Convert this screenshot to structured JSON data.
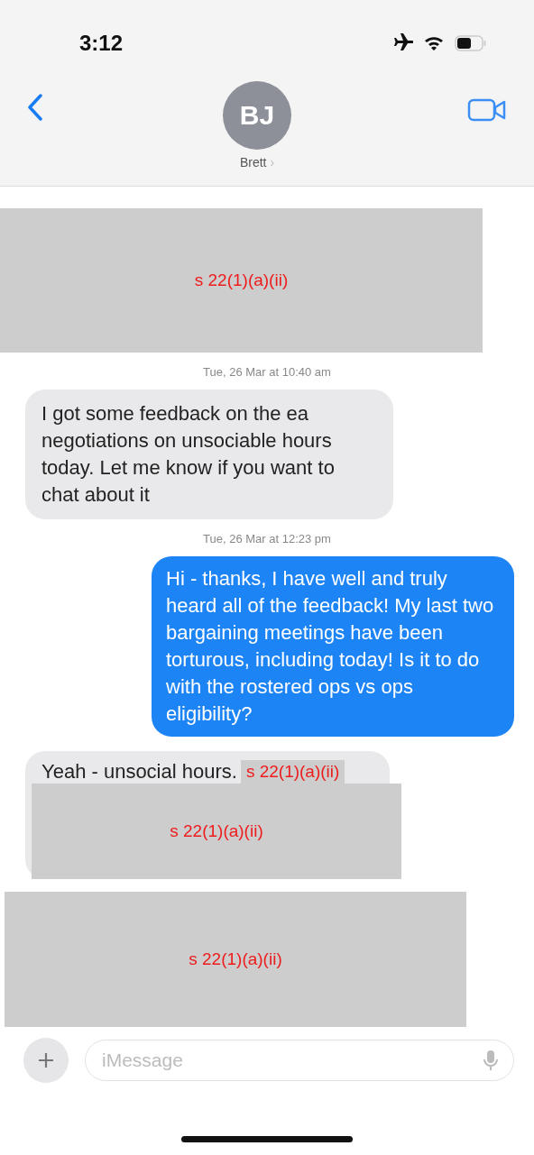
{
  "status_bar": {
    "time": "3:12"
  },
  "header": {
    "avatar_initials": "BJ",
    "contact_name": "Brett",
    "chevron": "›"
  },
  "messages": [
    {
      "kind": "redaction",
      "label": "s 22(1)(a)(ii)"
    },
    {
      "kind": "timestamp",
      "text": "Tue, 26 Mar at 10:40 am"
    },
    {
      "kind": "incoming",
      "text": "I got some feedback on the ea negotiations on unsociable hours today.  Let me know if you want to chat about it"
    },
    {
      "kind": "timestamp",
      "text": "Tue, 26 Mar at 12:23 pm"
    },
    {
      "kind": "outgoing",
      "text": "Hi - thanks, I have well and truly heard all of the feedback! My last two bargaining meetings have been torturous, including today! Is it to do with the rostered ops vs ops eligibility?"
    },
    {
      "kind": "incoming_redacted",
      "text": "Yeah - unsocial hours.",
      "inline_redaction": "s 22(1)(a)(ii)",
      "block_redaction": "s 22(1)(a)(ii)"
    },
    {
      "kind": "redaction",
      "label": "s 22(1)(a)(ii)"
    }
  ],
  "composer": {
    "placeholder": "iMessage"
  }
}
